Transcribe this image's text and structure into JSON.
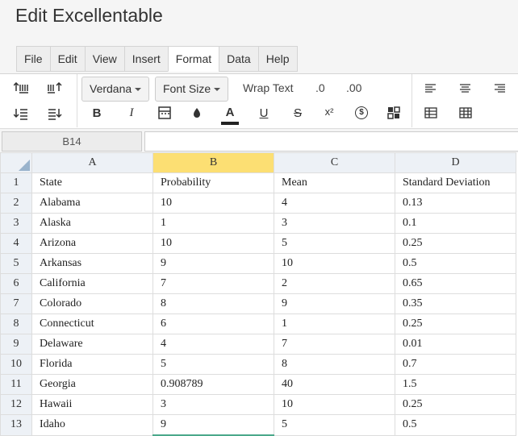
{
  "title": "Edit Excellentable",
  "menu": [
    "File",
    "Edit",
    "View",
    "Insert",
    "Format",
    "Data",
    "Help"
  ],
  "menu_active": "Format",
  "toolbar": {
    "font": "Verdana",
    "font_size": "Font Size",
    "wrap_text": "Wrap Text",
    "dec_decrease": ".0",
    "dec_increase": ".00",
    "bold": "B",
    "italic": "I",
    "font_color": "A",
    "underline": "U",
    "strike": "S",
    "superscript": "x²",
    "currency": "$"
  },
  "name_box": "B14",
  "formula": "",
  "columns": [
    "A",
    "B",
    "C",
    "D"
  ],
  "selected_column": "B",
  "rows": [
    {
      "n": "1",
      "cells": [
        "State",
        "Probability",
        "Mean",
        "Standard Deviation"
      ]
    },
    {
      "n": "2",
      "cells": [
        "Alabama",
        "10",
        "4",
        "0.13"
      ]
    },
    {
      "n": "3",
      "cells": [
        "Alaska",
        "1",
        "3",
        "0.1"
      ]
    },
    {
      "n": "4",
      "cells": [
        "Arizona",
        "10",
        "5",
        "0.25"
      ]
    },
    {
      "n": "5",
      "cells": [
        "Arkansas",
        "9",
        "10",
        "0.5"
      ]
    },
    {
      "n": "6",
      "cells": [
        "California",
        "7",
        "2",
        "0.65"
      ]
    },
    {
      "n": "7",
      "cells": [
        "Colorado",
        "8",
        "9",
        "0.35"
      ]
    },
    {
      "n": "8",
      "cells": [
        "Connecticut",
        "6",
        "1",
        "0.25"
      ]
    },
    {
      "n": "9",
      "cells": [
        "Delaware",
        "4",
        "7",
        "0.01"
      ]
    },
    {
      "n": "10",
      "cells": [
        "Florida",
        "5",
        "8",
        "0.7"
      ]
    },
    {
      "n": "11",
      "cells": [
        "Georgia",
        "0.908789",
        "40",
        "1.5"
      ]
    },
    {
      "n": "12",
      "cells": [
        "Hawaii",
        "3",
        "10",
        "0.25"
      ]
    },
    {
      "n": "13",
      "cells": [
        "Idaho",
        "9",
        "5",
        "0.5"
      ]
    }
  ]
}
